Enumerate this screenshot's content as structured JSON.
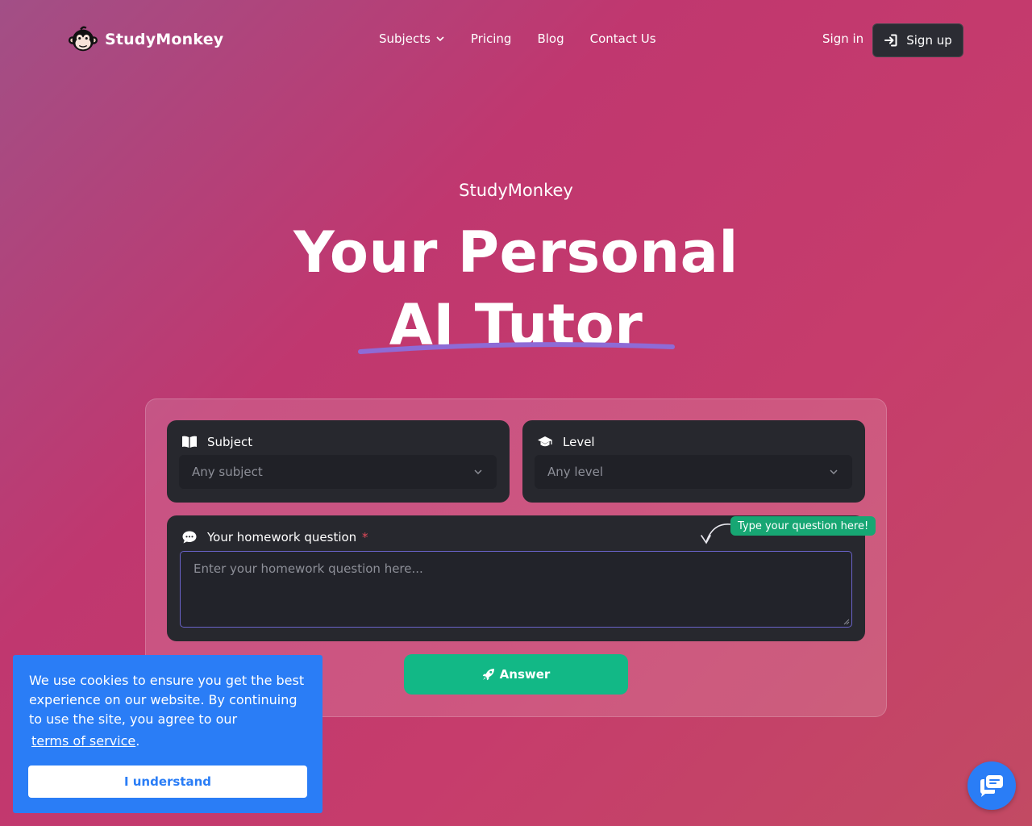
{
  "brand": {
    "name": "StudyMonkey"
  },
  "nav": {
    "items": [
      {
        "label": "Subjects",
        "has_dropdown": true
      },
      {
        "label": "Pricing"
      },
      {
        "label": "Blog"
      },
      {
        "label": "Contact Us"
      }
    ],
    "sign_in": "Sign in",
    "sign_up": "Sign up"
  },
  "hero": {
    "eyebrow": "StudyMonkey",
    "line1": "Your Personal",
    "line2": "AI Tutor"
  },
  "form": {
    "subject": {
      "label": "Subject",
      "value": "Any subject",
      "icon": "book-icon"
    },
    "level": {
      "label": "Level",
      "value": "Any level",
      "icon": "graduation-cap-icon"
    },
    "question": {
      "label": "Your homework question",
      "required_mark": "*",
      "placeholder": "Enter your homework question here...",
      "hint": "Type your question here!",
      "icon": "speech-bubble-icon"
    },
    "submit": "Answer"
  },
  "cookie": {
    "text": "We use cookies to ensure you get the best experience on our website. By continuing to use the site, you agree to our",
    "link": "terms of service",
    "period": ".",
    "button": "I understand"
  },
  "colors": {
    "accent_green": "#12b886",
    "cookie_blue": "#2a7df6",
    "card_dark": "#27282e",
    "underline_purple": "#8e6bd6"
  }
}
